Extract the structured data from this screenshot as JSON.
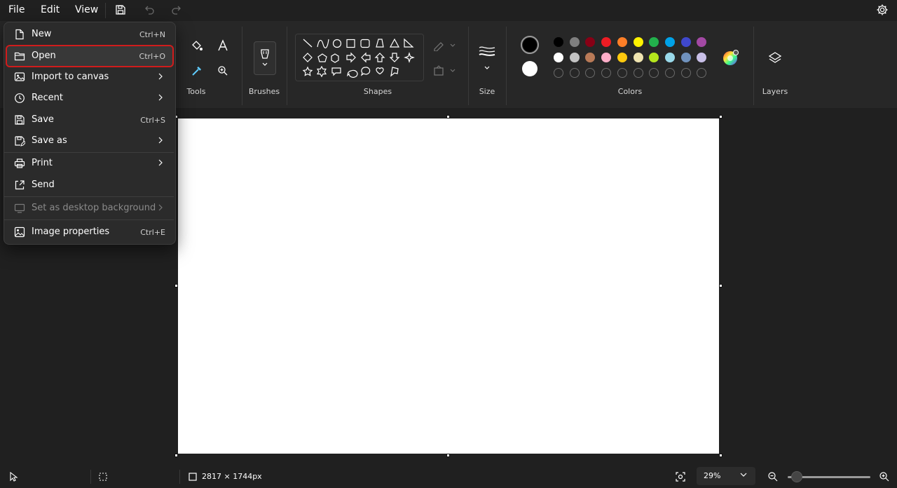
{
  "menubar": {
    "file": "File",
    "edit": "Edit",
    "view": "View"
  },
  "ribbon": {
    "tools_label": "Tools",
    "brushes_label": "Brushes",
    "shapes_label": "Shapes",
    "size_label": "Size",
    "colors_label": "Colors",
    "layers_label": "Layers"
  },
  "colors": {
    "primary": "#000000",
    "secondary": "#ffffff",
    "palette_row1": [
      "#000000",
      "#7f7f7f",
      "#880015",
      "#ed1c24",
      "#ff7f27",
      "#fff200",
      "#22b14c",
      "#00a2e8",
      "#3f48cc",
      "#a349a4"
    ],
    "palette_row2": [
      "#ffffff",
      "#c3c3c3",
      "#b97a57",
      "#ffaec9",
      "#ffc90e",
      "#efe4b0",
      "#b5e61d",
      "#99d9ea",
      "#7092be",
      "#c8bfe7"
    ],
    "custom_slots": 10
  },
  "file_menu": {
    "items": [
      {
        "label": "New",
        "shortcut": "Ctrl+N",
        "icon": "new-file-icon"
      },
      {
        "label": "Open",
        "shortcut": "Ctrl+O",
        "icon": "open-folder-icon"
      },
      {
        "label": "Import to canvas",
        "shortcut": "",
        "icon": "import-icon"
      },
      {
        "label": "Recent",
        "shortcut": "",
        "icon": "clock-icon"
      },
      {
        "label": "Save",
        "shortcut": "Ctrl+S",
        "icon": "save-icon"
      },
      {
        "label": "Save as",
        "shortcut": "",
        "icon": "save-as-icon"
      },
      {
        "label": "Print",
        "shortcut": "",
        "icon": "print-icon"
      },
      {
        "label": "Send",
        "shortcut": "",
        "icon": "share-icon"
      },
      {
        "label": "Set as desktop background",
        "shortcut": "",
        "icon": "desktop-icon"
      },
      {
        "label": "Image properties",
        "shortcut": "Ctrl+E",
        "icon": "image-properties-icon"
      }
    ]
  },
  "status": {
    "canvas_size": "2817 × 1744px",
    "zoom": "29%",
    "zoom_level": 0.05
  }
}
